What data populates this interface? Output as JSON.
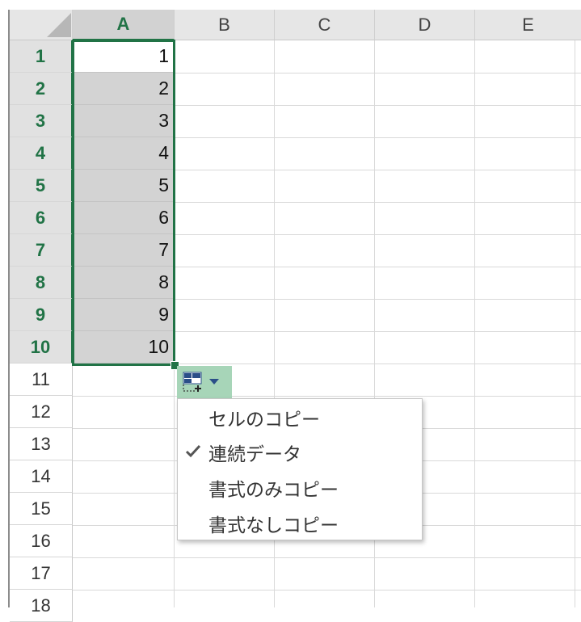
{
  "columns": [
    "A",
    "B",
    "C",
    "D",
    "E"
  ],
  "rows": [
    "1",
    "2",
    "3",
    "4",
    "5",
    "6",
    "7",
    "8",
    "9",
    "10",
    "11",
    "12",
    "13",
    "14",
    "15",
    "16",
    "17",
    "18"
  ],
  "cells_a": [
    "1",
    "2",
    "3",
    "4",
    "5",
    "6",
    "7",
    "8",
    "9",
    "10"
  ],
  "autofill": {
    "icon": "autofill-options-icon",
    "menu": [
      {
        "label": "セルのコピー",
        "checked": false
      },
      {
        "label": "連続データ",
        "checked": true
      },
      {
        "label": "書式のみコピー",
        "checked": false
      },
      {
        "label": "書式なしコピー",
        "checked": false
      }
    ]
  },
  "colors": {
    "accent": "#217346",
    "selection_fill": "#d3d3d3",
    "autofill_button": "#a7d5b8"
  }
}
